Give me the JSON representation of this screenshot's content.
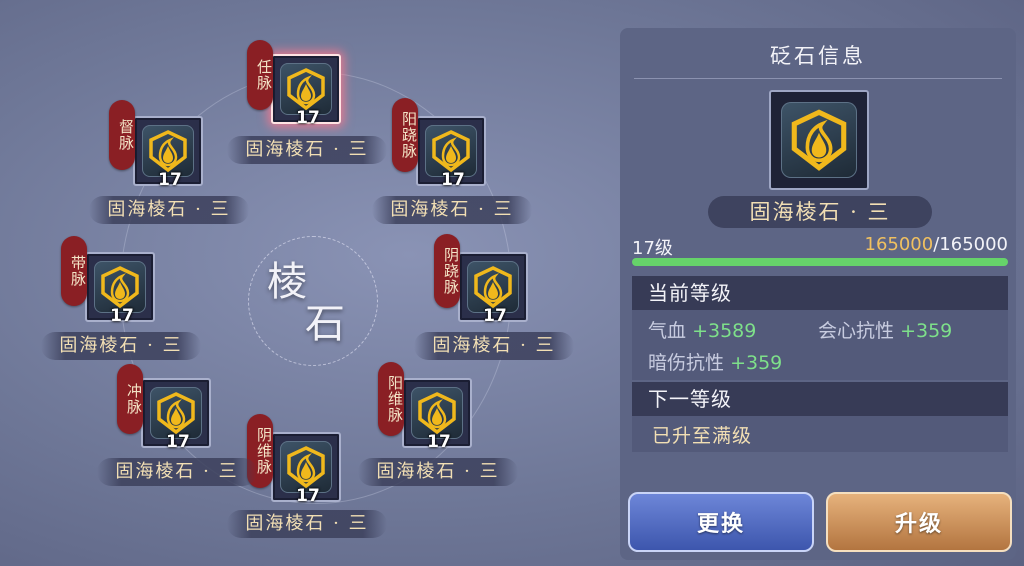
{
  "center_title": [
    "棱",
    "石"
  ],
  "slots": [
    {
      "tag": "任脉",
      "level": "17",
      "name": "固海棱石 · 三",
      "selected": true
    },
    {
      "tag": "阳跷脉",
      "level": "17",
      "name": "固海棱石 · 三"
    },
    {
      "tag": "阴跷脉",
      "level": "17",
      "name": "固海棱石 · 三"
    },
    {
      "tag": "阳维脉",
      "level": "17",
      "name": "固海棱石 · 三"
    },
    {
      "tag": "阴维脉",
      "level": "17",
      "name": "固海棱石 · 三"
    },
    {
      "tag": "冲脉",
      "level": "17",
      "name": "固海棱石 · 三"
    },
    {
      "tag": "带脉",
      "level": "17",
      "name": "固海棱石 · 三"
    },
    {
      "tag": "督脉",
      "level": "17",
      "name": "固海棱石 · 三"
    }
  ],
  "panel": {
    "title": "砭石信息",
    "stone_name": "固海棱石 · 三",
    "level_label": "17级",
    "exp_current": "165000",
    "exp_max": "/165000",
    "exp_progress": 1.0,
    "current_level_header": "当前等级",
    "stats": [
      {
        "label": "气血",
        "value": "+3589"
      },
      {
        "label": "会心抗性",
        "value": "+359"
      },
      {
        "label": "暗伤抗性",
        "value": "+359"
      }
    ],
    "next_level_header": "下一等级",
    "next_level_text": "已升至满级"
  },
  "buttons": {
    "swap": "更换",
    "upgrade": "升级"
  },
  "colors": {
    "accent_gold": "#f2dfb4",
    "stat_green": "#7ee08a",
    "tag_red": "#8a1f24",
    "exp_bar": "#66d36a"
  }
}
